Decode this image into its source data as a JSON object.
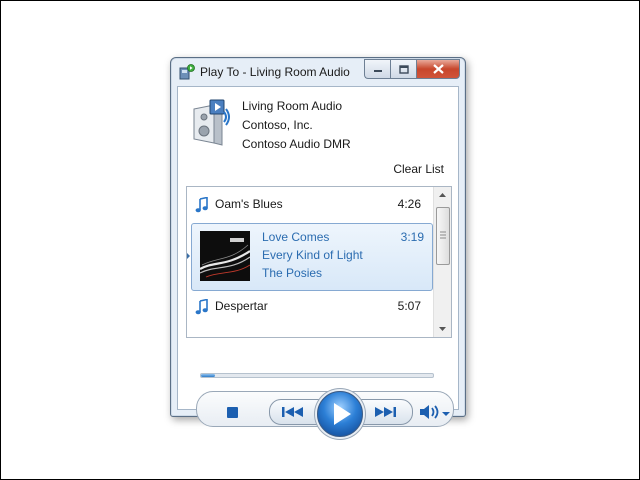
{
  "window": {
    "title": "Play To - Living Room Audio"
  },
  "device": {
    "name": "Living Room Audio",
    "manufacturer": "Contoso, Inc.",
    "model": "Contoso Audio DMR"
  },
  "toolbar": {
    "clear_list_label": "Clear List"
  },
  "playlist": {
    "items": [
      {
        "title": "Oam's Blues",
        "duration": "4:26"
      },
      {
        "title": "Love Comes",
        "album": "Every Kind of Light",
        "artist": "The Posies",
        "duration": "3:19",
        "selected": true
      },
      {
        "title": "Despertar",
        "duration": "5:07"
      }
    ]
  },
  "playback": {
    "progress_fraction": 0.06
  },
  "colors": {
    "accent": "#2b6cb0",
    "selection_bg": "#d8e8f8",
    "close_button": "#c7462c"
  },
  "icons": [
    "play-to-icon",
    "minimize-icon",
    "maximize-icon",
    "close-icon",
    "speaker-device-icon",
    "music-note-icon",
    "stop-icon",
    "previous-icon",
    "play-icon",
    "next-icon",
    "volume-icon"
  ]
}
